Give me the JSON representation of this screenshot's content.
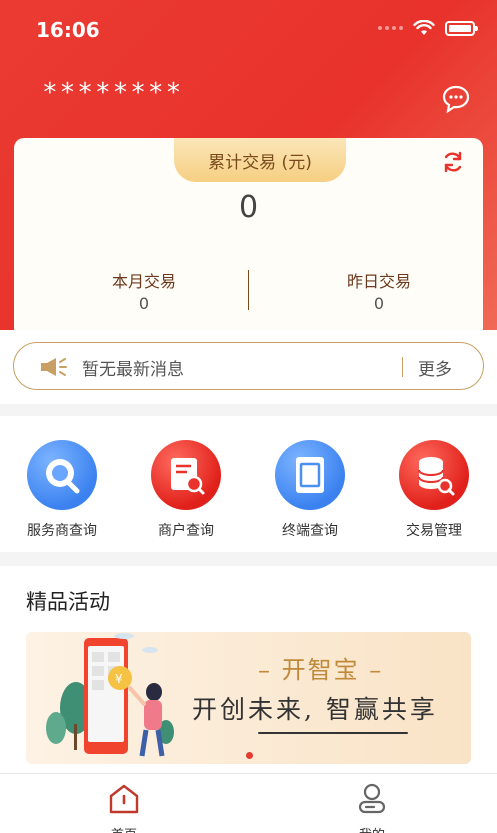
{
  "status_bar": {
    "time": "16:06"
  },
  "header": {
    "username": "********"
  },
  "summary": {
    "total_label": "累计交易 (元)",
    "total_value": "0",
    "month_label": "本月交易",
    "month_value": "0",
    "yesterday_label": "昨日交易",
    "yesterday_value": "0"
  },
  "notice": {
    "text": "暂无最新消息",
    "more": "更多"
  },
  "menu": [
    {
      "label": "服务商查询",
      "icon": "search-icon",
      "color": "#4a90f0"
    },
    {
      "label": "商户查询",
      "icon": "merchant-query-icon",
      "color": "#e8322b"
    },
    {
      "label": "终端查询",
      "icon": "terminal-icon",
      "color": "#4a90f0"
    },
    {
      "label": "交易管理",
      "icon": "transaction-db-icon",
      "color": "#e8322b"
    }
  ],
  "activity": {
    "title": "精品活动",
    "banner_title": "– 开智宝 –",
    "banner_slogan": "开创未来, 智赢共享"
  },
  "tabbar": {
    "home": "首页",
    "mine": "我的"
  },
  "colors": {
    "brand_red": "#e8322b",
    "gold": "#c8a063"
  }
}
